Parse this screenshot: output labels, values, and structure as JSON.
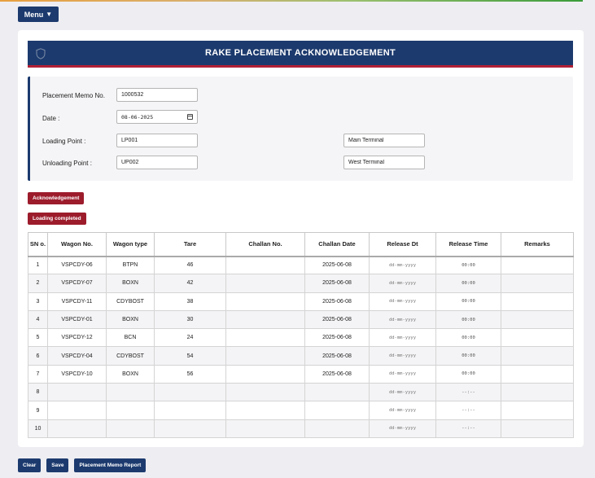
{
  "menu": {
    "label": "Menu",
    "caret": "▼"
  },
  "header": {
    "title": "RAKE PLACEMENT ACKNOWLEDGEMENT",
    "icon": "shield-icon"
  },
  "form": {
    "memo_label": "Placement Memo No.",
    "memo_value": "1000532",
    "date_label": "Date :",
    "date_value": "08-06-2025",
    "loading_label": "Loading Point :",
    "loading_code": "LP001",
    "loading_name": "Main Terminal",
    "unloading_label": "Unloading Point :",
    "unloading_code": "UP002",
    "unloading_name": "West Terminal"
  },
  "actions": {
    "acknowledgement": "Acknowledgement",
    "loading_completed": "Loading completed"
  },
  "table": {
    "headers": [
      "SN o.",
      "Wagon No.",
      "Wagon type",
      "Tare",
      "Challan No.",
      "Challan Date",
      "Release Dt",
      "Release Time",
      "Remarks"
    ],
    "rows": [
      {
        "sn": "1",
        "wagon": "VSPCDY-06",
        "type": "BTPN",
        "tare": "46",
        "challan": "",
        "challan_date": "2025-06-08",
        "release_dt": "dd-mm-yyyy",
        "release_time": "00:00",
        "remarks": ""
      },
      {
        "sn": "2",
        "wagon": "VSPCDY-07",
        "type": "BOXN",
        "tare": "42",
        "challan": "",
        "challan_date": "2025-06-08",
        "release_dt": "dd-mm-yyyy",
        "release_time": "00:00",
        "remarks": ""
      },
      {
        "sn": "3",
        "wagon": "VSPCDY-11",
        "type": "CDYBOST",
        "tare": "38",
        "challan": "",
        "challan_date": "2025-06-08",
        "release_dt": "dd-mm-yyyy",
        "release_time": "00:00",
        "remarks": ""
      },
      {
        "sn": "4",
        "wagon": "VSPCDY-01",
        "type": "BOXN",
        "tare": "30",
        "challan": "",
        "challan_date": "2025-06-08",
        "release_dt": "dd-mm-yyyy",
        "release_time": "00:00",
        "remarks": ""
      },
      {
        "sn": "5",
        "wagon": "VSPCDY-12",
        "type": "BCN",
        "tare": "24",
        "challan": "",
        "challan_date": "2025-06-08",
        "release_dt": "dd-mm-yyyy",
        "release_time": "00:00",
        "remarks": ""
      },
      {
        "sn": "6",
        "wagon": "VSPCDY-04",
        "type": "CDYBOST",
        "tare": "54",
        "challan": "",
        "challan_date": "2025-06-08",
        "release_dt": "dd-mm-yyyy",
        "release_time": "00:00",
        "remarks": ""
      },
      {
        "sn": "7",
        "wagon": "VSPCDY-10",
        "type": "BOXN",
        "tare": "56",
        "challan": "",
        "challan_date": "2025-06-08",
        "release_dt": "dd-mm-yyyy",
        "release_time": "00:00",
        "remarks": ""
      },
      {
        "sn": "8",
        "wagon": "",
        "type": "",
        "tare": "",
        "challan": "",
        "challan_date": "",
        "release_dt": "dd-mm-yyyy",
        "release_time": "--:--",
        "remarks": ""
      },
      {
        "sn": "9",
        "wagon": "",
        "type": "",
        "tare": "",
        "challan": "",
        "challan_date": "",
        "release_dt": "dd-mm-yyyy",
        "release_time": "--:--",
        "remarks": ""
      },
      {
        "sn": "10",
        "wagon": "",
        "type": "",
        "tare": "",
        "challan": "",
        "challan_date": "",
        "release_dt": "dd-mm-yyyy",
        "release_time": "--:--",
        "remarks": ""
      }
    ]
  },
  "footer": {
    "clear": "Clear",
    "save": "Save",
    "report": "Placement Memo Report"
  }
}
